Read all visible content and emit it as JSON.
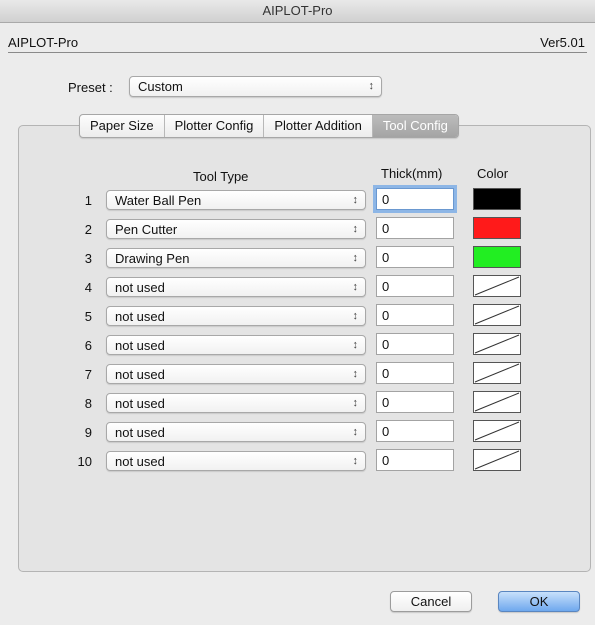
{
  "window": {
    "title": "AIPLOT-Pro"
  },
  "header": {
    "app_name": "AIPLOT-Pro",
    "version": "Ver5.01"
  },
  "preset": {
    "label": "Preset :",
    "value": "Custom"
  },
  "tabs": [
    {
      "label": "Paper Size",
      "active": false
    },
    {
      "label": "Plotter Config",
      "active": false
    },
    {
      "label": "Plotter Addition",
      "active": false
    },
    {
      "label": "Tool Config",
      "active": true
    }
  ],
  "table": {
    "tool_type_header": "Tool Type",
    "thick_header": "Thick(mm)",
    "color_header": "Color",
    "rows": [
      {
        "num": "1",
        "tool": "Water Ball Pen",
        "thick": "0",
        "color": "#000000"
      },
      {
        "num": "2",
        "tool": "Pen Cutter",
        "thick": "0",
        "color": "#ff1a1a"
      },
      {
        "num": "3",
        "tool": "Drawing Pen",
        "thick": "0",
        "color": "#22ee22"
      },
      {
        "num": "4",
        "tool": "not used",
        "thick": "0",
        "color": "none"
      },
      {
        "num": "5",
        "tool": "not used",
        "thick": "0",
        "color": "none"
      },
      {
        "num": "6",
        "tool": "not used",
        "thick": "0",
        "color": "none"
      },
      {
        "num": "7",
        "tool": "not used",
        "thick": "0",
        "color": "none"
      },
      {
        "num": "8",
        "tool": "not used",
        "thick": "0",
        "color": "none"
      },
      {
        "num": "9",
        "tool": "not used",
        "thick": "0",
        "color": "none"
      },
      {
        "num": "10",
        "tool": "not used",
        "thick": "0",
        "color": "none"
      }
    ]
  },
  "buttons": {
    "cancel": "Cancel",
    "ok": "OK"
  },
  "icons": {
    "select_arrows": "updown-arrows-icon"
  },
  "updown_glyph": "↕"
}
